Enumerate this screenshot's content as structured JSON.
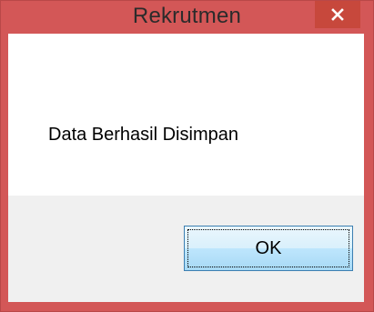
{
  "window": {
    "title": "Rekrutmen",
    "close_icon": "close-icon",
    "frame_color": "#d35757",
    "close_button_color": "#c7483c"
  },
  "dialog": {
    "message": "Data Berhasil Disimpan",
    "ok_label": "OK"
  }
}
